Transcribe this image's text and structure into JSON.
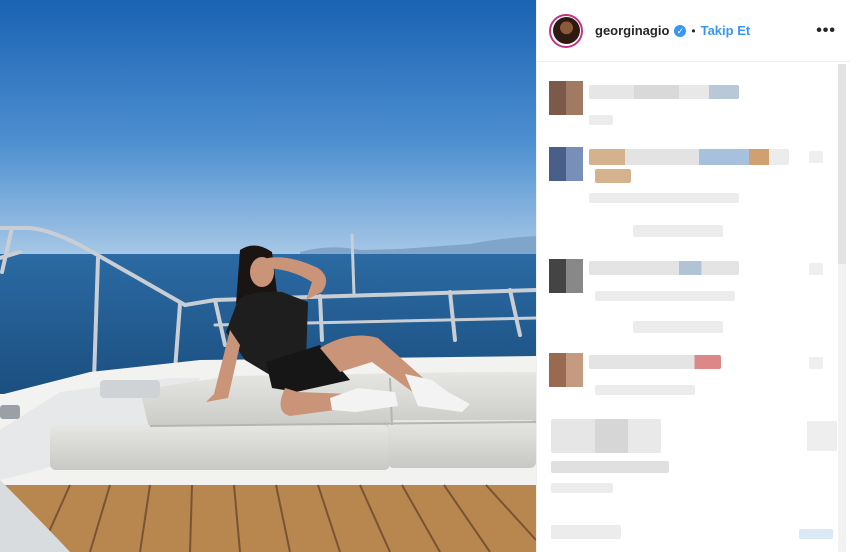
{
  "post": {
    "photo_description_icon": "photo",
    "colors": {
      "sky_top": "#1d6fbf",
      "sky_bottom": "#8fb9de",
      "sea": "#1f5a8f",
      "deck_cushion": "#d9d9d6",
      "wood": "#b88a56"
    }
  },
  "header": {
    "username": "georginagio",
    "verified_icon": "verified-badge-icon",
    "separator": "•",
    "follow_label": "Takip Et",
    "more_icon": "ellipsis-icon",
    "more_label": "•••"
  },
  "comments_note": "comments are pixelated/obscured in the screenshot"
}
